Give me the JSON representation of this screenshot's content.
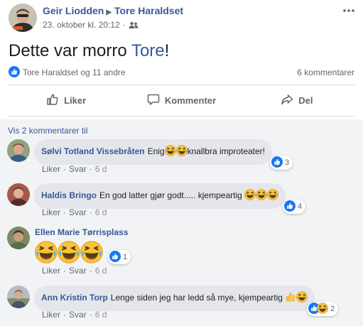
{
  "post": {
    "author": "Geir Liodden",
    "target": "Tore Haraldset",
    "timestamp": "23. oktober kl. 20:12",
    "audience_icon": "friends-icon",
    "text_prefix": "Dette var morro ",
    "text_mention": "Tore",
    "text_suffix": "!",
    "reactions_summary": "Tore Haraldset og 11 andre",
    "comments_count": "6 kommentarer"
  },
  "actions": {
    "like": "Liker",
    "comment": "Kommenter",
    "share": "Del"
  },
  "comments_section": {
    "view_more": "Vis 2 kommentarer til",
    "like_label": "Liker",
    "reply_label": "Svar",
    "items": [
      {
        "name": "Sølvi Totland Vissebråten",
        "text_a": "Enig",
        "text_b": "knallbra improteater!",
        "time": "6 d",
        "reactions": "3"
      },
      {
        "name": "Haldis Bringo",
        "text": "En god latter gjør godt..... kjempeartig",
        "time": "6 d",
        "reactions": "4"
      },
      {
        "name": "Ellen Marie Tørrisplass",
        "time": "6 d",
        "reactions": "1"
      },
      {
        "name": "Ann Kristin Torp",
        "text": "Lenge siden jeg har ledd så mye, kjempeartig",
        "time": "6 d",
        "reactions": "2"
      }
    ]
  },
  "colors": {
    "link": "#385898",
    "secondary": "#606770",
    "like_blue": "#1877f2",
    "bubble": "#e4e6eb"
  }
}
